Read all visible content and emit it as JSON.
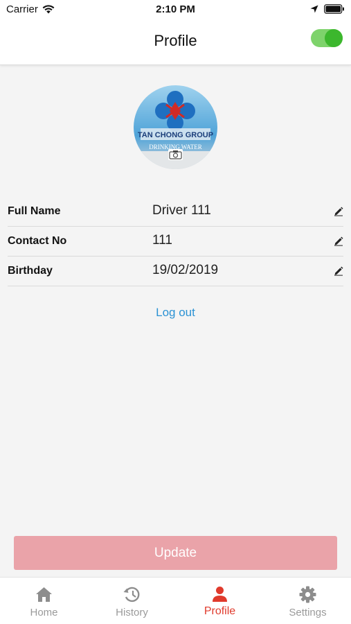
{
  "status_bar": {
    "carrier": "Carrier",
    "time": "2:10 PM"
  },
  "header": {
    "title": "Profile",
    "toggle_on": true
  },
  "avatar": {
    "logo_text_1": "TAN CHONG GROUP",
    "logo_text_2": "DRINKING WATER"
  },
  "profile": {
    "rows": [
      {
        "label": "Full Name",
        "value": "Driver 111"
      },
      {
        "label": "Contact No",
        "value": "111"
      },
      {
        "label": "Birthday",
        "value": "19/02/2019"
      }
    ]
  },
  "logout_label": "Log out",
  "update_label": "Update",
  "tabs": [
    {
      "label": "Home",
      "icon": "home-icon",
      "active": false
    },
    {
      "label": "History",
      "icon": "history-icon",
      "active": false
    },
    {
      "label": "Profile",
      "icon": "person-icon",
      "active": true
    },
    {
      "label": "Settings",
      "icon": "gear-icon",
      "active": false
    }
  ],
  "colors": {
    "accent": "#e03a2c",
    "link": "#2b92d4",
    "toggle": "#3cb72d",
    "update_button": "#eaa3a9"
  }
}
